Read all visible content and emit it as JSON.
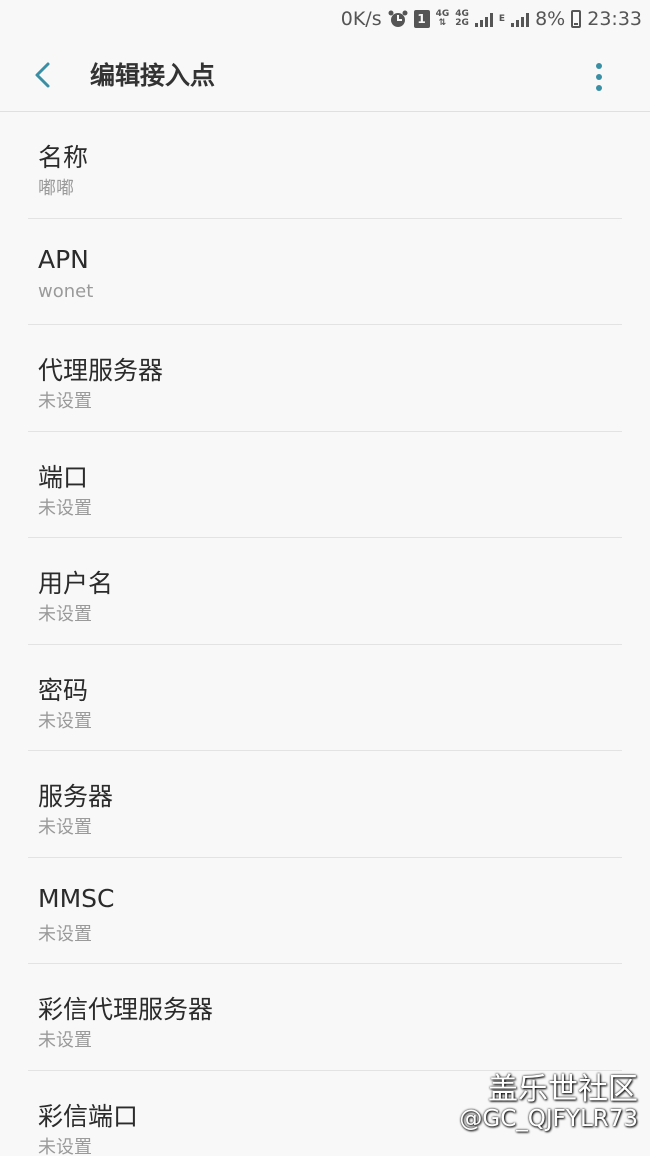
{
  "status_bar": {
    "speed": "0K/s",
    "sim_slot": "1",
    "net_a": "4G",
    "net_b_top": "4G",
    "net_b_bottom": "2G",
    "net_c": "E",
    "battery": "8%",
    "time": "23:33"
  },
  "app_bar": {
    "title": "编辑接入点"
  },
  "items": [
    {
      "label": "名称",
      "value": "嘟嘟"
    },
    {
      "label": "APN",
      "value": "wonet"
    },
    {
      "label": "代理服务器",
      "value": "未设置"
    },
    {
      "label": "端口",
      "value": "未设置"
    },
    {
      "label": "用户名",
      "value": "未设置"
    },
    {
      "label": "密码",
      "value": "未设置"
    },
    {
      "label": "服务器",
      "value": "未设置"
    },
    {
      "label": "MMSC",
      "value": "未设置"
    },
    {
      "label": "彩信代理服务器",
      "value": "未设置"
    },
    {
      "label": "彩信端口",
      "value": "未设置"
    }
  ],
  "watermark": {
    "site": "盖乐世社区",
    "user": "@GC_QJFYLR73"
  },
  "colors": {
    "accent": "#3a8fa4",
    "background": "#f8f8f8",
    "divider": "#e3e3e3"
  }
}
